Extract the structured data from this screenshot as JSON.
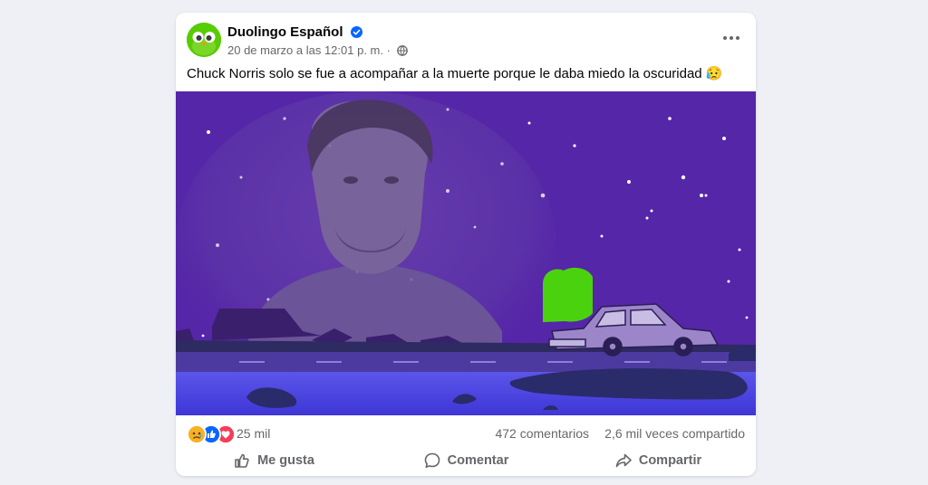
{
  "post": {
    "page_name": "Duolingo Español",
    "timestamp": "20 de marzo a las 12:01 p. m.",
    "separator": "·",
    "text": "Chuck Norris solo se fue a acompañar a la muerte porque le daba miedo la oscuridad",
    "text_emoji": "😥"
  },
  "stats": {
    "reaction_types": [
      "sad",
      "like",
      "love"
    ],
    "reaction_count": "25 mil",
    "comments": "472 comentarios",
    "shares": "2,6 mil veces compartido"
  },
  "actions": {
    "like": "Me gusta",
    "comment": "Comentar",
    "share": "Compartir"
  },
  "colors": {
    "page_background": "#eef0f5",
    "verified_blue": "#0866ff",
    "duolingo_green": "#58cc02",
    "night_sky": "#5526a8",
    "road_blue": "#4b3fe0",
    "secondary_text": "#65676b"
  }
}
